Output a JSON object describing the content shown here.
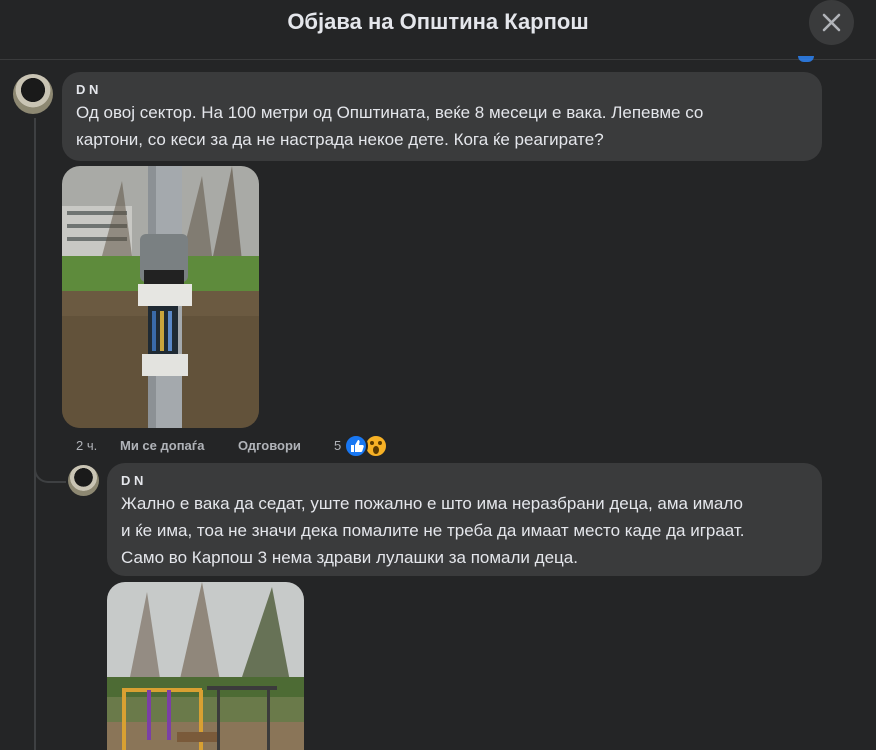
{
  "header": {
    "title": "Објава на Општина Карпош"
  },
  "comment": {
    "author": "D       N",
    "text_lines": [
      "Од овој сектор. На 100 метри од Општината, веќе 8 месеци е вака. Лепевме со",
      "картони, со кеси за да не настрада некое дете. Кога ќе реагирате?"
    ],
    "time": "2 ч.",
    "like_label": "Ми се допаѓа",
    "reply_label": "Одговори",
    "reaction_count": "5",
    "reactions": [
      "like-icon",
      "wow-icon"
    ]
  },
  "reply": {
    "author": "D       N",
    "text_lines": [
      "Жално е вака да седат, уште пожално е што има неразбрани деца, ама имало",
      "и ќе има, тоа не значи дека помалите не треба да имаат место каде да играат.",
      "Само во Карпош 3 нема здрави лулашки за помали деца."
    ]
  },
  "colors": {
    "background": "#242526",
    "bubble": "#3a3b3c",
    "text": "#e4e6eb",
    "secondary_text": "#b0b3b8",
    "like_blue": "#1877f2",
    "wow_yellow": "#f7b125"
  }
}
